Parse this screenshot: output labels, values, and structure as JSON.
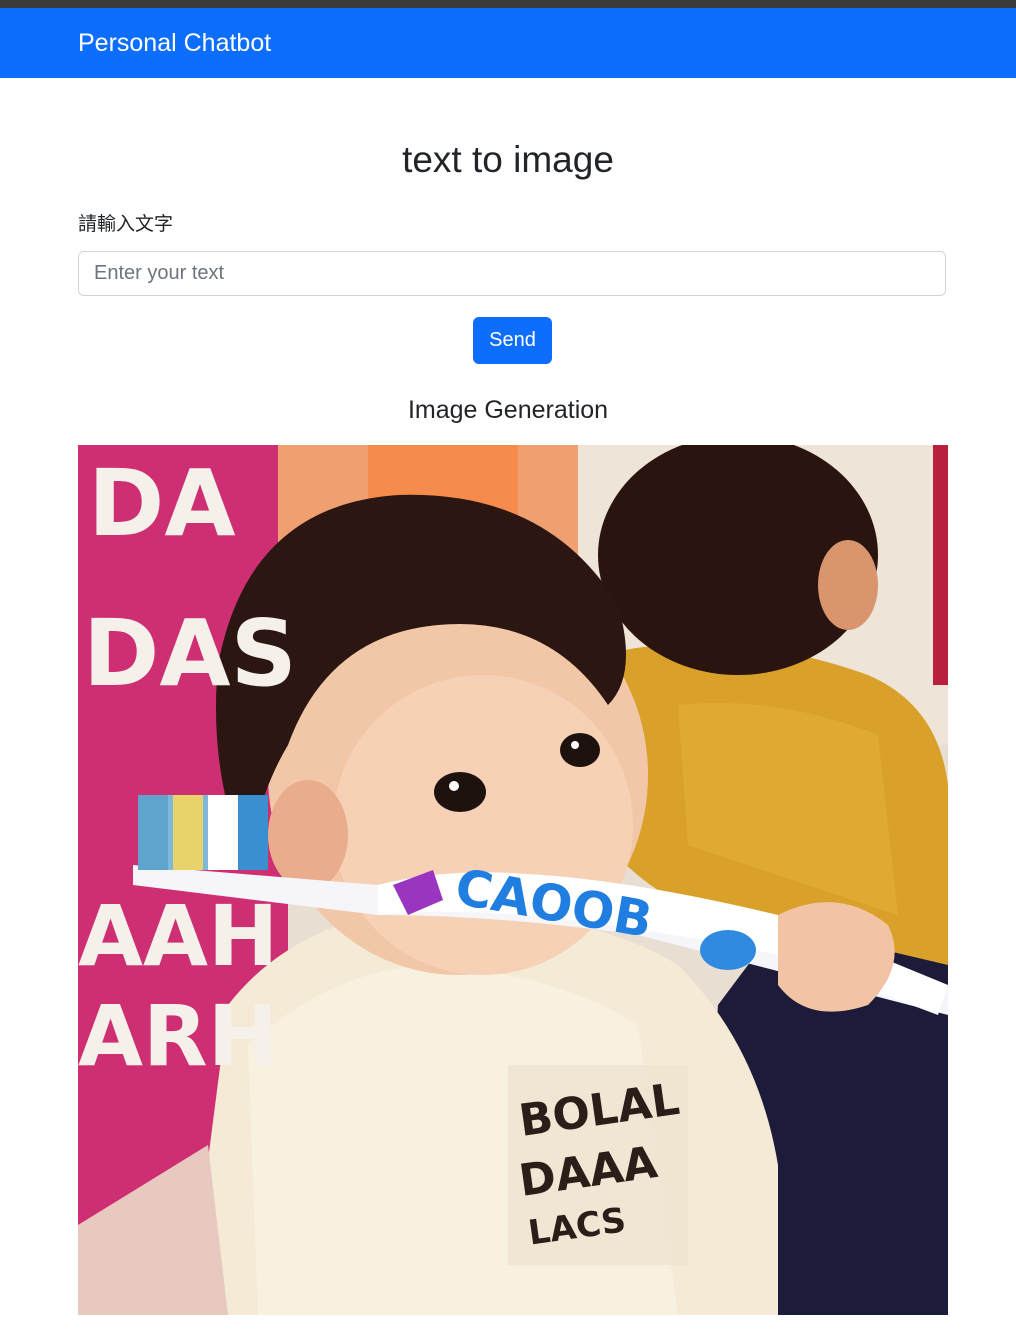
{
  "navbar": {
    "brand": "Personal Chatbot",
    "color": "#0d6efd"
  },
  "main": {
    "title": "text to image",
    "input_label": "請輸入文字",
    "input_placeholder": "Enter your text",
    "input_value": "",
    "send_label": "Send",
    "result_title": "Image Generation"
  },
  "image": {
    "alt": "generated image",
    "painted_text": [
      "DA",
      "DAS",
      "AAH",
      "ARH",
      "CAOOB",
      "BOLAL",
      "DAAA",
      "LACS"
    ]
  }
}
